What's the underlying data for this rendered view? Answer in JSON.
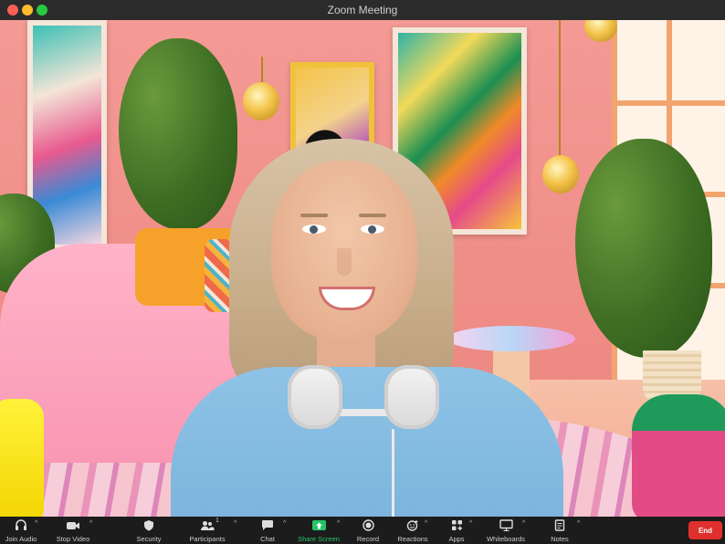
{
  "window": {
    "title": "Zoom Meeting"
  },
  "toolbar": {
    "items": [
      {
        "label": "Join Audio",
        "icon": "headphones-icon",
        "caret": "^"
      },
      {
        "label": "Stop Video",
        "icon": "video-camera-icon",
        "caret": "^"
      },
      {
        "label": "Security",
        "icon": "shield-icon"
      },
      {
        "label": "Participants",
        "icon": "participants-icon",
        "count": "1",
        "caret": "^"
      },
      {
        "label": "Chat",
        "icon": "chat-bubble-icon",
        "caret": "^"
      },
      {
        "label": "Share Screen",
        "icon": "share-screen-icon",
        "caret": "^"
      },
      {
        "label": "Record",
        "icon": "record-icon"
      },
      {
        "label": "Reactions",
        "icon": "reactions-icon",
        "caret": "^"
      },
      {
        "label": "Apps",
        "icon": "apps-icon",
        "caret": "^"
      },
      {
        "label": "Whiteboards",
        "icon": "whiteboard-icon",
        "caret": "^"
      },
      {
        "label": "Notes",
        "icon": "notes-icon",
        "caret": "^"
      }
    ],
    "end_label": "End"
  },
  "colors": {
    "share_green": "#26c466",
    "end_red": "#e0302d",
    "toolbar_bg": "#1c1c1c"
  }
}
